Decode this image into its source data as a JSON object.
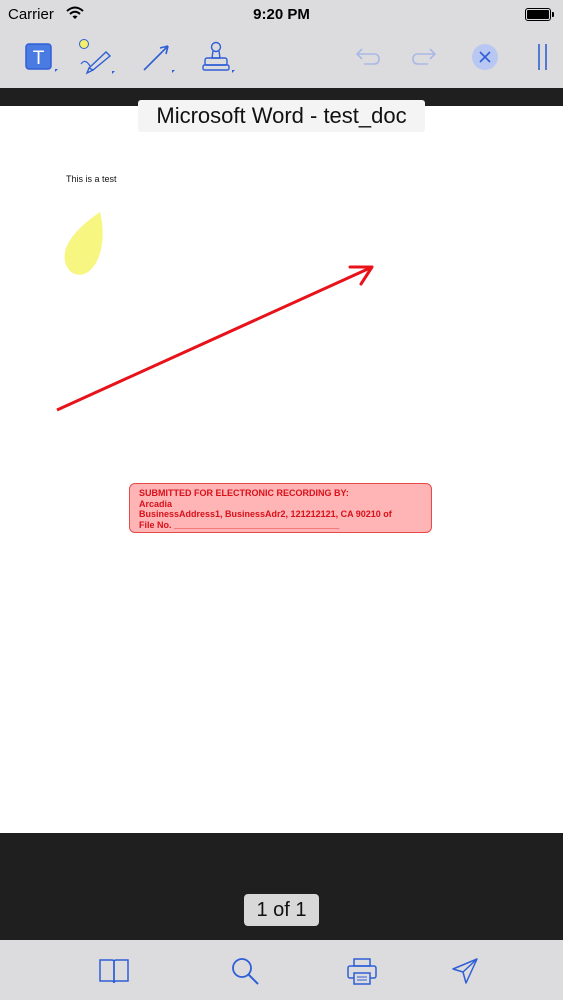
{
  "status_bar": {
    "carrier": "Carrier",
    "time": "9:20 PM"
  },
  "toolbar": {
    "tools": [
      {
        "name": "text-tool",
        "icon": "text-box-icon"
      },
      {
        "name": "highlighter-tool",
        "icon": "highlighter-pen-icon"
      },
      {
        "name": "arrow-tool",
        "icon": "arrow-line-icon"
      },
      {
        "name": "stamp-tool",
        "icon": "stamp-icon"
      },
      {
        "name": "undo",
        "icon": "undo-icon"
      },
      {
        "name": "redo",
        "icon": "redo-icon"
      },
      {
        "name": "close",
        "icon": "close-circle-icon"
      },
      {
        "name": "pause",
        "icon": "pause-bars-icon"
      }
    ],
    "accent_color": "#2f5fd6",
    "disabled_color": "#a9b8e6"
  },
  "document": {
    "title": "Microsoft Word - test_doc",
    "body_text": "This is a test",
    "highlight_color": "#f7f57a",
    "arrow_color": "#e8121a",
    "stamp": {
      "line1": "SUBMITTED FOR ELECTRONIC RECORDING BY:",
      "line2": "Arcadia",
      "line3": "BusinessAddress1, BusinessAdr2, 121212121, CA 90210   of",
      "line4": "File No. _________________________________",
      "color": "#d9101a"
    }
  },
  "pagination": {
    "label": "1 of 1"
  },
  "bottom_toolbar": {
    "items": [
      {
        "name": "bookmarks",
        "icon": "open-book-icon"
      },
      {
        "name": "search",
        "icon": "search-icon"
      },
      {
        "name": "print",
        "icon": "printer-icon"
      },
      {
        "name": "share",
        "icon": "send-icon"
      }
    ]
  }
}
